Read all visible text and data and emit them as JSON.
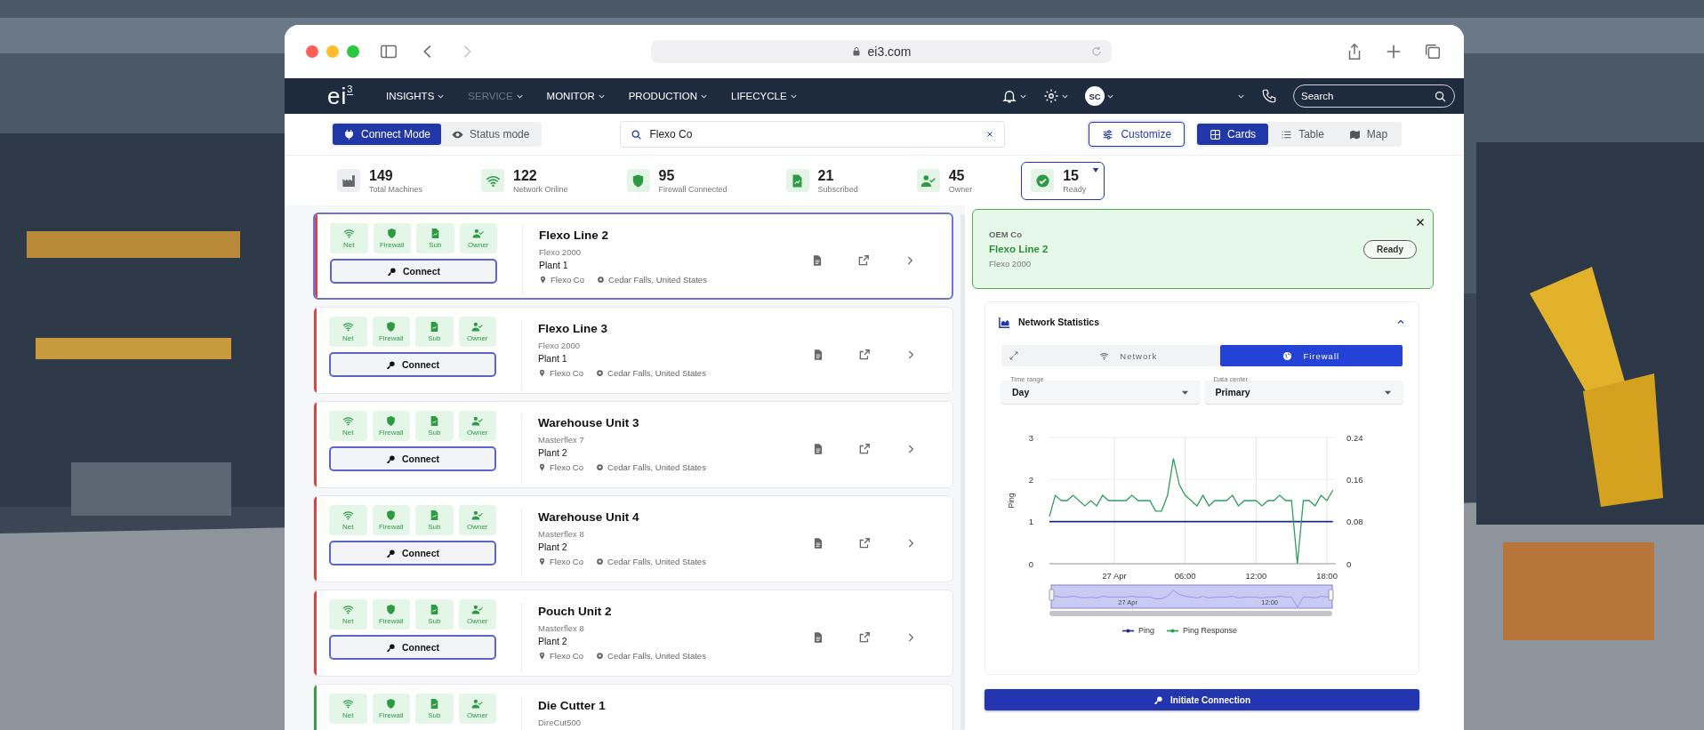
{
  "browser": {
    "url": "ei3.com",
    "back_enabled": true,
    "forward_enabled": false
  },
  "nav": {
    "logo": "ei$^{3}$",
    "items": [
      {
        "label": "INSIGHTS",
        "disabled": false
      },
      {
        "label": "SERVICE",
        "disabled": true
      },
      {
        "label": "MONITOR",
        "disabled": false
      },
      {
        "label": "PRODUCTION",
        "disabled": false
      },
      {
        "label": "LIFECYCLE",
        "disabled": false
      }
    ],
    "avatar": "SC",
    "search": {
      "placeholder": "Search"
    }
  },
  "modes": [
    {
      "kind": "connect",
      "label": "Connect Mode",
      "selected": true
    },
    {
      "kind": "status",
      "label": "Status mode",
      "selected": false
    }
  ],
  "filter": {
    "value": "Flexo Co"
  },
  "customize": "Customize",
  "views": [
    {
      "kind": "cards",
      "label": "Cards",
      "selected": true
    },
    {
      "kind": "table",
      "label": "Table",
      "selected": false
    },
    {
      "kind": "map",
      "label": "Map",
      "selected": false
    }
  ],
  "stats": [
    {
      "kind": "machines",
      "value": "149",
      "label": "Total Machines",
      "selected": false
    },
    {
      "kind": "net",
      "value": "122",
      "label": "Network Online",
      "selected": false
    },
    {
      "kind": "firewall",
      "value": "95",
      "label": "Firewall Connected",
      "selected": false
    },
    {
      "kind": "sub",
      "value": "21",
      "label": "Subscribed",
      "selected": false
    },
    {
      "kind": "owner",
      "value": "45",
      "label": "Owner",
      "selected": false
    },
    {
      "kind": "ready",
      "value": "15",
      "label": "Ready",
      "selected": true
    }
  ],
  "machines": [
    {
      "name": "Flexo Line 2",
      "model": "Flexo 2000",
      "plant": "Plant 1",
      "company": "Flexo Co",
      "location": "Cedar Falls, United States",
      "color": "#d64545",
      "selected": true,
      "badges": [
        {
          "kind": "net",
          "label": "Net"
        },
        {
          "kind": "firewall",
          "label": "Firewall"
        },
        {
          "kind": "sub",
          "label": "Sub"
        },
        {
          "kind": "owner",
          "label": "Owner"
        }
      ],
      "button": "Connect"
    },
    {
      "name": "Flexo Line 3",
      "model": "Flexo 2000",
      "plant": "Plant 1",
      "company": "Flexo Co",
      "location": "Cedar Falls, United States",
      "color": "#d64545",
      "selected": false,
      "badges": [
        {
          "kind": "net",
          "label": "Net"
        },
        {
          "kind": "firewall",
          "label": "Firewall"
        },
        {
          "kind": "sub",
          "label": "Sub"
        },
        {
          "kind": "owner",
          "label": "Owner"
        }
      ],
      "button": "Connect"
    },
    {
      "name": "Warehouse Unit 3",
      "model": "Masterflex 7",
      "plant": "Plant 2",
      "company": "Flexo Co",
      "location": "Cedar Falls, United States",
      "color": "#d64545",
      "selected": false,
      "badges": [
        {
          "kind": "net",
          "label": "Net"
        },
        {
          "kind": "firewall",
          "label": "Firewall"
        },
        {
          "kind": "sub",
          "label": "Sub"
        },
        {
          "kind": "owner",
          "label": "Owner"
        }
      ],
      "button": "Connect"
    },
    {
      "name": "Warehouse Unit 4",
      "model": "Masterflex 8",
      "plant": "Plant 2",
      "company": "Flexo Co",
      "location": "Cedar Falls, United States",
      "color": "#d64545",
      "selected": false,
      "badges": [
        {
          "kind": "net",
          "label": "Net"
        },
        {
          "kind": "firewall",
          "label": "Firewall"
        },
        {
          "kind": "sub",
          "label": "Sub"
        },
        {
          "kind": "owner",
          "label": "Owner"
        }
      ],
      "button": "Connect"
    },
    {
      "name": "Pouch Unit 2",
      "model": "Masterflex 8",
      "plant": "Plant 2",
      "company": "Flexo Co",
      "location": "Cedar Falls, United States",
      "color": "#d64545",
      "selected": false,
      "badges": [
        {
          "kind": "net",
          "label": "Net"
        },
        {
          "kind": "firewall",
          "label": "Firewall"
        },
        {
          "kind": "sub",
          "label": "Sub"
        },
        {
          "kind": "owner",
          "label": "Owner"
        }
      ],
      "button": "Connect"
    },
    {
      "name": "Die Cutter 1",
      "model": "DireCut500",
      "color": "#3a9a4a",
      "selected": false,
      "badges": [
        {
          "kind": "net",
          "label": "Net"
        },
        {
          "kind": "firewall",
          "label": "Firewall"
        },
        {
          "kind": "sub",
          "label": "Sub"
        },
        {
          "kind": "owner",
          "label": "Owner"
        }
      ]
    }
  ],
  "detail": {
    "company": "OEM Co",
    "name": "Flexo Line 2",
    "model": "Flexo 2000",
    "status": "Ready"
  },
  "stats_panel": {
    "title": "Network Statistics",
    "expanded": true,
    "tabs": [
      {
        "kind": "network",
        "label": "Network",
        "selected": false
      },
      {
        "kind": "firewall",
        "label": "Firewall",
        "selected": true
      }
    ],
    "selects": [
      {
        "label": "Time range",
        "value": "Day"
      },
      {
        "label": "Data center",
        "value": "Primary"
      }
    ],
    "chart_data": {
      "type": "line",
      "ylabel": "Ping",
      "grid": true,
      "legend": "bottom",
      "xlim": [
        -5.5,
        18.75
      ],
      "ylim": [
        0,
        3
      ],
      "y2lim": [
        0,
        0.24
      ],
      "xticks": [
        {
          "value": 0,
          "label": "27 Apr"
        },
        {
          "value": 6,
          "label": "06:00"
        },
        {
          "value": 12,
          "label": "12:00"
        },
        {
          "value": 18,
          "label": "18:00"
        }
      ],
      "yticks": [
        0,
        1,
        2,
        3
      ],
      "y2ticks": [
        0,
        0.08,
        0.16,
        0.24
      ],
      "x": [
        -5.5,
        -5,
        -4.5,
        -4,
        -3.5,
        -3,
        -2.5,
        -2,
        -1.5,
        -1,
        -0.5,
        0,
        0.5,
        1,
        1.5,
        2,
        2.5,
        3,
        3.5,
        4,
        4.5,
        5,
        5.5,
        6,
        6.5,
        7,
        7.5,
        8,
        8.5,
        9,
        9.5,
        10,
        10.5,
        11,
        11.5,
        12,
        12.5,
        13,
        13.5,
        14,
        14.5,
        15,
        15.5,
        16,
        16.5,
        17,
        17.5,
        18,
        18.5
      ],
      "series": [
        {
          "name": "Ping",
          "color": "#1f2a8a",
          "axis": "y",
          "values": [
            1,
            1,
            1,
            1,
            1,
            1,
            1,
            1,
            1,
            1,
            1,
            1,
            1,
            1,
            1,
            1,
            1,
            1,
            1,
            1,
            1,
            1,
            1,
            1,
            1,
            1,
            1,
            1,
            1,
            1,
            1,
            1,
            1,
            1,
            1,
            1,
            1,
            1,
            1,
            1,
            1,
            1,
            1,
            1,
            1,
            1,
            1,
            1,
            1
          ]
        },
        {
          "name": "Ping Response",
          "color": "#2e9e5b",
          "axis": "y2",
          "values": [
            0.09,
            0.13,
            0.12,
            0.12,
            0.13,
            0.12,
            0.11,
            0.12,
            0.11,
            0.13,
            0.12,
            0.12,
            0.12,
            0.12,
            0.13,
            0.12,
            0.12,
            0.12,
            0.1,
            0.1,
            0.13,
            0.2,
            0.15,
            0.13,
            0.12,
            0.11,
            0.13,
            0.11,
            0.12,
            0.12,
            0.12,
            0.13,
            0.11,
            0.12,
            0.12,
            0.12,
            0.11,
            0.12,
            0.12,
            0.13,
            0.12,
            0.12,
            0.0,
            0.12,
            0.12,
            0.11,
            0.13,
            0.12,
            0.14
          ]
        }
      ]
    },
    "navigator_labels": [
      "27 Apr",
      "12:00"
    ]
  },
  "action": "Initiate Connection"
}
